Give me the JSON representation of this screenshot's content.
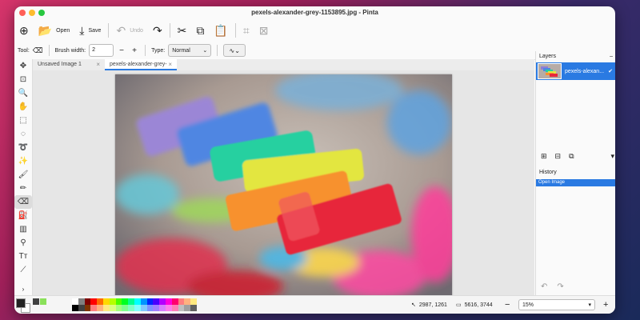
{
  "window": {
    "title": "pexels-alexander-grey-1153895.jpg - Pinta"
  },
  "toolbar": {
    "buttons": [
      {
        "name": "new-button",
        "icon": "new-image-icon",
        "glyph": "⊕",
        "label": "",
        "enabled": true
      },
      {
        "name": "open-button",
        "icon": "folder-open-icon",
        "glyph": "📂",
        "label": "Open",
        "enabled": true
      },
      {
        "name": "save-button",
        "icon": "save-icon",
        "glyph": "⤓",
        "label": "Save",
        "enabled": true
      },
      {
        "name": "undo-button",
        "icon": "undo-icon",
        "glyph": "↶",
        "label": "Undo",
        "enabled": false
      },
      {
        "name": "redo-button",
        "icon": "redo-icon",
        "glyph": "↷",
        "label": "",
        "enabled": true
      },
      {
        "name": "cut-button",
        "icon": "scissors-icon",
        "glyph": "✂",
        "label": "",
        "enabled": true
      },
      {
        "name": "copy-button",
        "icon": "copy-icon",
        "glyph": "⧉",
        "label": "",
        "enabled": true
      },
      {
        "name": "paste-button",
        "icon": "clipboard-icon",
        "glyph": "📋",
        "label": "",
        "enabled": true
      },
      {
        "name": "crop-button",
        "icon": "crop-icon",
        "glyph": "⌗",
        "label": "",
        "enabled": false
      },
      {
        "name": "deselect-button",
        "icon": "deselect-icon",
        "glyph": "⊠",
        "label": "",
        "enabled": false
      }
    ]
  },
  "options": {
    "tool_label": "Tool:",
    "brush_width_label": "Brush width:",
    "brush_width_value": "2",
    "minus": "−",
    "plus": "+",
    "type_label": "Type:",
    "type_value": "Normal",
    "antialias_glyph": "∿",
    "chevron": "⌄"
  },
  "tools": [
    {
      "name": "move-selected-tool",
      "icon": "move-icon",
      "glyph": "✥"
    },
    {
      "name": "move-selection-tool",
      "icon": "move-selection-icon",
      "glyph": "⊡"
    },
    {
      "name": "zoom-tool",
      "icon": "zoom-icon",
      "glyph": "🔍"
    },
    {
      "name": "pan-tool",
      "icon": "hand-icon",
      "glyph": "✋"
    },
    {
      "name": "rectangle-select-tool",
      "icon": "rectangle-select-icon",
      "glyph": "⬚"
    },
    {
      "name": "ellipse-select-tool",
      "icon": "ellipse-select-icon",
      "glyph": "◌"
    },
    {
      "name": "lasso-select-tool",
      "icon": "lasso-icon",
      "glyph": "➰"
    },
    {
      "name": "magic-wand-tool",
      "icon": "magic-wand-icon",
      "glyph": "✨"
    },
    {
      "name": "paintbrush-tool",
      "icon": "paintbrush-icon",
      "glyph": "🖌"
    },
    {
      "name": "pencil-tool",
      "icon": "pencil-icon",
      "glyph": "✏"
    },
    {
      "name": "eraser-tool",
      "icon": "eraser-icon",
      "glyph": "⌫",
      "active": true
    },
    {
      "name": "paint-bucket-tool",
      "icon": "paint-bucket-icon",
      "glyph": "⛽"
    },
    {
      "name": "gradient-tool",
      "icon": "gradient-icon",
      "glyph": "▥"
    },
    {
      "name": "color-picker-tool",
      "icon": "color-picker-icon",
      "glyph": "⚲"
    },
    {
      "name": "text-tool",
      "icon": "text-icon",
      "glyph": "Tт"
    },
    {
      "name": "line-curve-tool",
      "icon": "line-curve-icon",
      "glyph": "⟋"
    }
  ],
  "tools_expand": "›",
  "tabs": [
    {
      "label": "Unsaved Image 1",
      "close": "×",
      "active": false
    },
    {
      "label": "pexels-alexander-grey-1...",
      "close": "×",
      "active": true
    }
  ],
  "layers": {
    "title": "Layers",
    "collapse": "–",
    "items": [
      {
        "name": "pexels-alexan...",
        "visible_check": "✔"
      }
    ],
    "actions": [
      {
        "name": "add-layer-button",
        "icon": "add-layer-icon",
        "glyph": "⊞"
      },
      {
        "name": "delete-layer-button",
        "icon": "delete-layer-icon",
        "glyph": "⊟"
      },
      {
        "name": "duplicate-layer-button",
        "icon": "duplicate-layer-icon",
        "glyph": "⧉"
      },
      {
        "name": "layer-menu-button",
        "icon": "dropdown-icon",
        "glyph": "▾"
      }
    ]
  },
  "history": {
    "title": "History",
    "collapse": "–",
    "items": [
      "Open Image"
    ],
    "undo_glyph": "↶",
    "redo_glyph": "↷"
  },
  "status": {
    "cursor_position": "2987, 1261",
    "image_size": "5616, 3744",
    "zoom": "15%",
    "zoom_minus": "−",
    "zoom_plus": "+",
    "zoom_chevron": "▾"
  },
  "palette": {
    "primary_color": "#222222",
    "secondary_color": "#ffffff",
    "recent_colors": [
      "#404040",
      "#8ae05a"
    ],
    "swatches": [
      "#ffffff",
      "#808080",
      "#7f0000",
      "#ff0000",
      "#ff6a00",
      "#ffd800",
      "#b6ff00",
      "#4cff00",
      "#00ff21",
      "#00ff90",
      "#00ffff",
      "#0094ff",
      "#0026ff",
      "#4800ff",
      "#b200ff",
      "#ff00dc",
      "#ff006e",
      "#ff7f7f",
      "#ffb27f",
      "#ffe97f",
      "#000000",
      "#404040",
      "#7f3300",
      "#ff7f7f",
      "#ffb27f",
      "#ffe97f",
      "#daff7f",
      "#a5ff7f",
      "#7fff8e",
      "#7fffc5",
      "#7fffff",
      "#7fc9ff",
      "#7f92ff",
      "#a17fff",
      "#d67fff",
      "#ff7fed",
      "#ff7fb6",
      "#c0c0c0",
      "#a0a0a0",
      "#606060"
    ]
  }
}
